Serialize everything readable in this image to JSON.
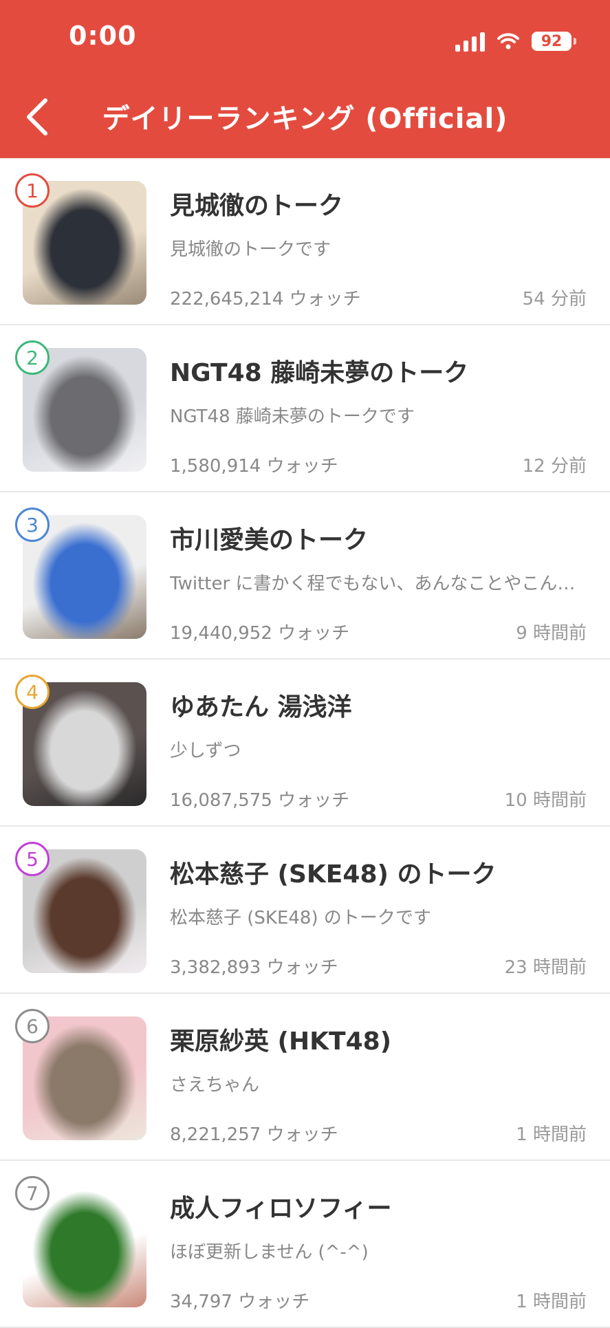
{
  "status_bar": {
    "time": "0:00",
    "battery": "92"
  },
  "header": {
    "title": "デイリーランキング (Official)"
  },
  "rankings": [
    {
      "rank": "1",
      "title": "見城徹のトーク",
      "description": "見城徹のトークです",
      "watches": "222,645,214 ウォッチ",
      "time": "54 分前",
      "rank_color": "#e44b3f",
      "thumb_colors": [
        "#e9dcc8",
        "#2c3038",
        "#9a8a78"
      ]
    },
    {
      "rank": "2",
      "title": "NGT48 藤崎未夢のトーク",
      "description": "NGT48 藤崎未夢のトークです",
      "watches": "1,580,914 ウォッチ",
      "time": "12 分前",
      "rank_color": "#3cb878",
      "thumb_colors": [
        "#d7d9df",
        "#6c6c70",
        "#f1f1f3"
      ]
    },
    {
      "rank": "3",
      "title": "市川愛美のトーク",
      "description": "Twitter に書かく程でもない、あんなことやこんなこと",
      "watches": "19,440,952 ウォッチ",
      "time": "9 時間前",
      "rank_color": "#4a86d4",
      "thumb_colors": [
        "#eeeeee",
        "#3a6fd0",
        "#8a7a6a"
      ]
    },
    {
      "rank": "4",
      "title": "ゆあたん 湯浅洋",
      "description": "少しずつ",
      "watches": "16,087,575 ウォッチ",
      "time": "10 時間前",
      "rank_color": "#e6a630",
      "thumb_colors": [
        "#5b5250",
        "#d8d8d8",
        "#2a2a2a"
      ]
    },
    {
      "rank": "5",
      "title": "松本慈子 (SKE48) のトーク",
      "description": "松本慈子 (SKE48) のトークです",
      "watches": "3,382,893 ウォッチ",
      "time": "23 時間前",
      "rank_color": "#c23ed8",
      "thumb_colors": [
        "#cfcfcf",
        "#5a3a2c",
        "#f1ecef"
      ]
    },
    {
      "rank": "6",
      "title": "栗原紗英 (HKT48)",
      "description": "さえちゃん",
      "watches": "8,221,257 ウォッチ",
      "time": "1 時間前",
      "rank_color": "#8c8c8c",
      "thumb_colors": [
        "#f2c7cc",
        "#8b7a6a",
        "#ede6dc"
      ]
    },
    {
      "rank": "7",
      "title": "成人フィロソフィー",
      "description": "ほぼ更新しません (^-^)",
      "watches": "34,797 ウォッチ",
      "time": "1 時間前",
      "rank_color": "#8c8c8c",
      "thumb_colors": [
        "#ffffff",
        "#2f7a2a",
        "#c98a7a"
      ]
    }
  ]
}
